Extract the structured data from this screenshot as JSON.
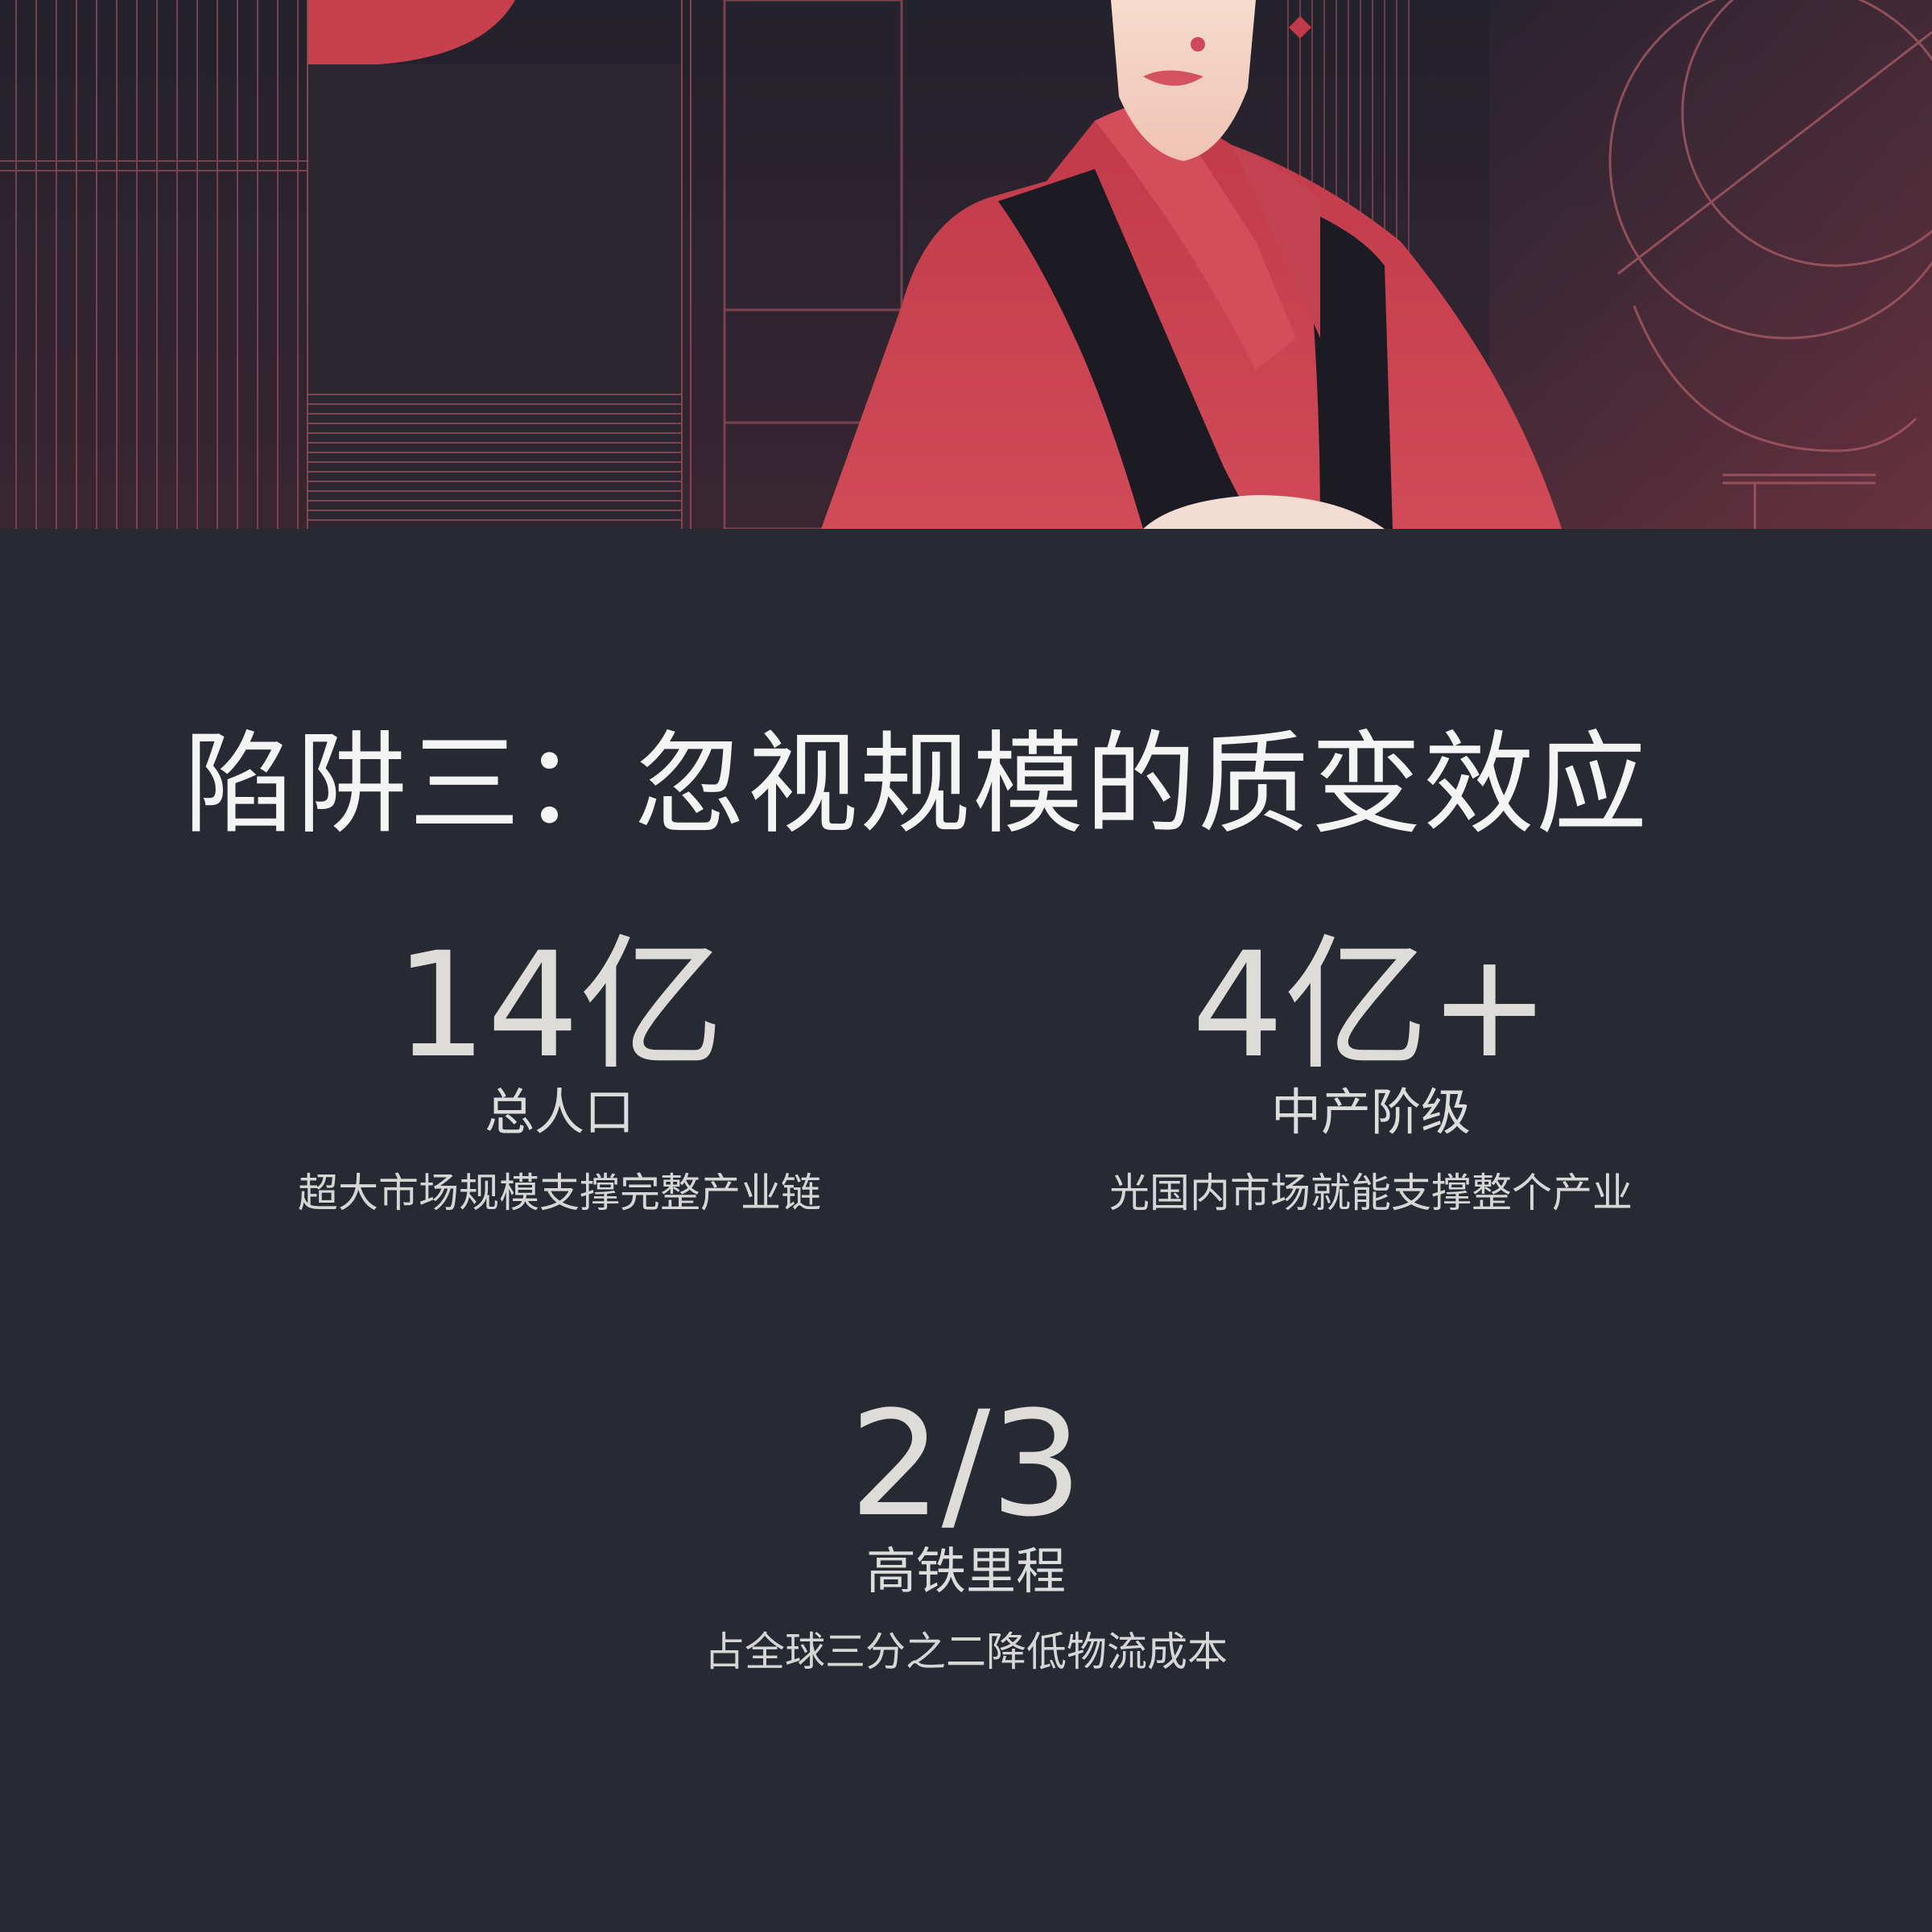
{
  "slide": {
    "title": "陷阱三：忽视规模的质变效应"
  },
  "stats": [
    {
      "value": "14亿",
      "label": "总人口",
      "description": "超大市场规模支撑完整产业链"
    },
    {
      "value": "4亿+",
      "label": "中产阶级",
      "description": "光国内市场就能支撑整个产业"
    },
    {
      "value": "2/3",
      "label": "高铁里程",
      "description": "占全球三分之二降低物流成本"
    }
  ],
  "colors": {
    "background": "#282a33",
    "accent_red": "#c9434f",
    "text_primary": "#f4f4f4",
    "text_secondary": "#d6d6d6"
  },
  "hero": {
    "image": "illustration-woman-in-red-robe"
  }
}
